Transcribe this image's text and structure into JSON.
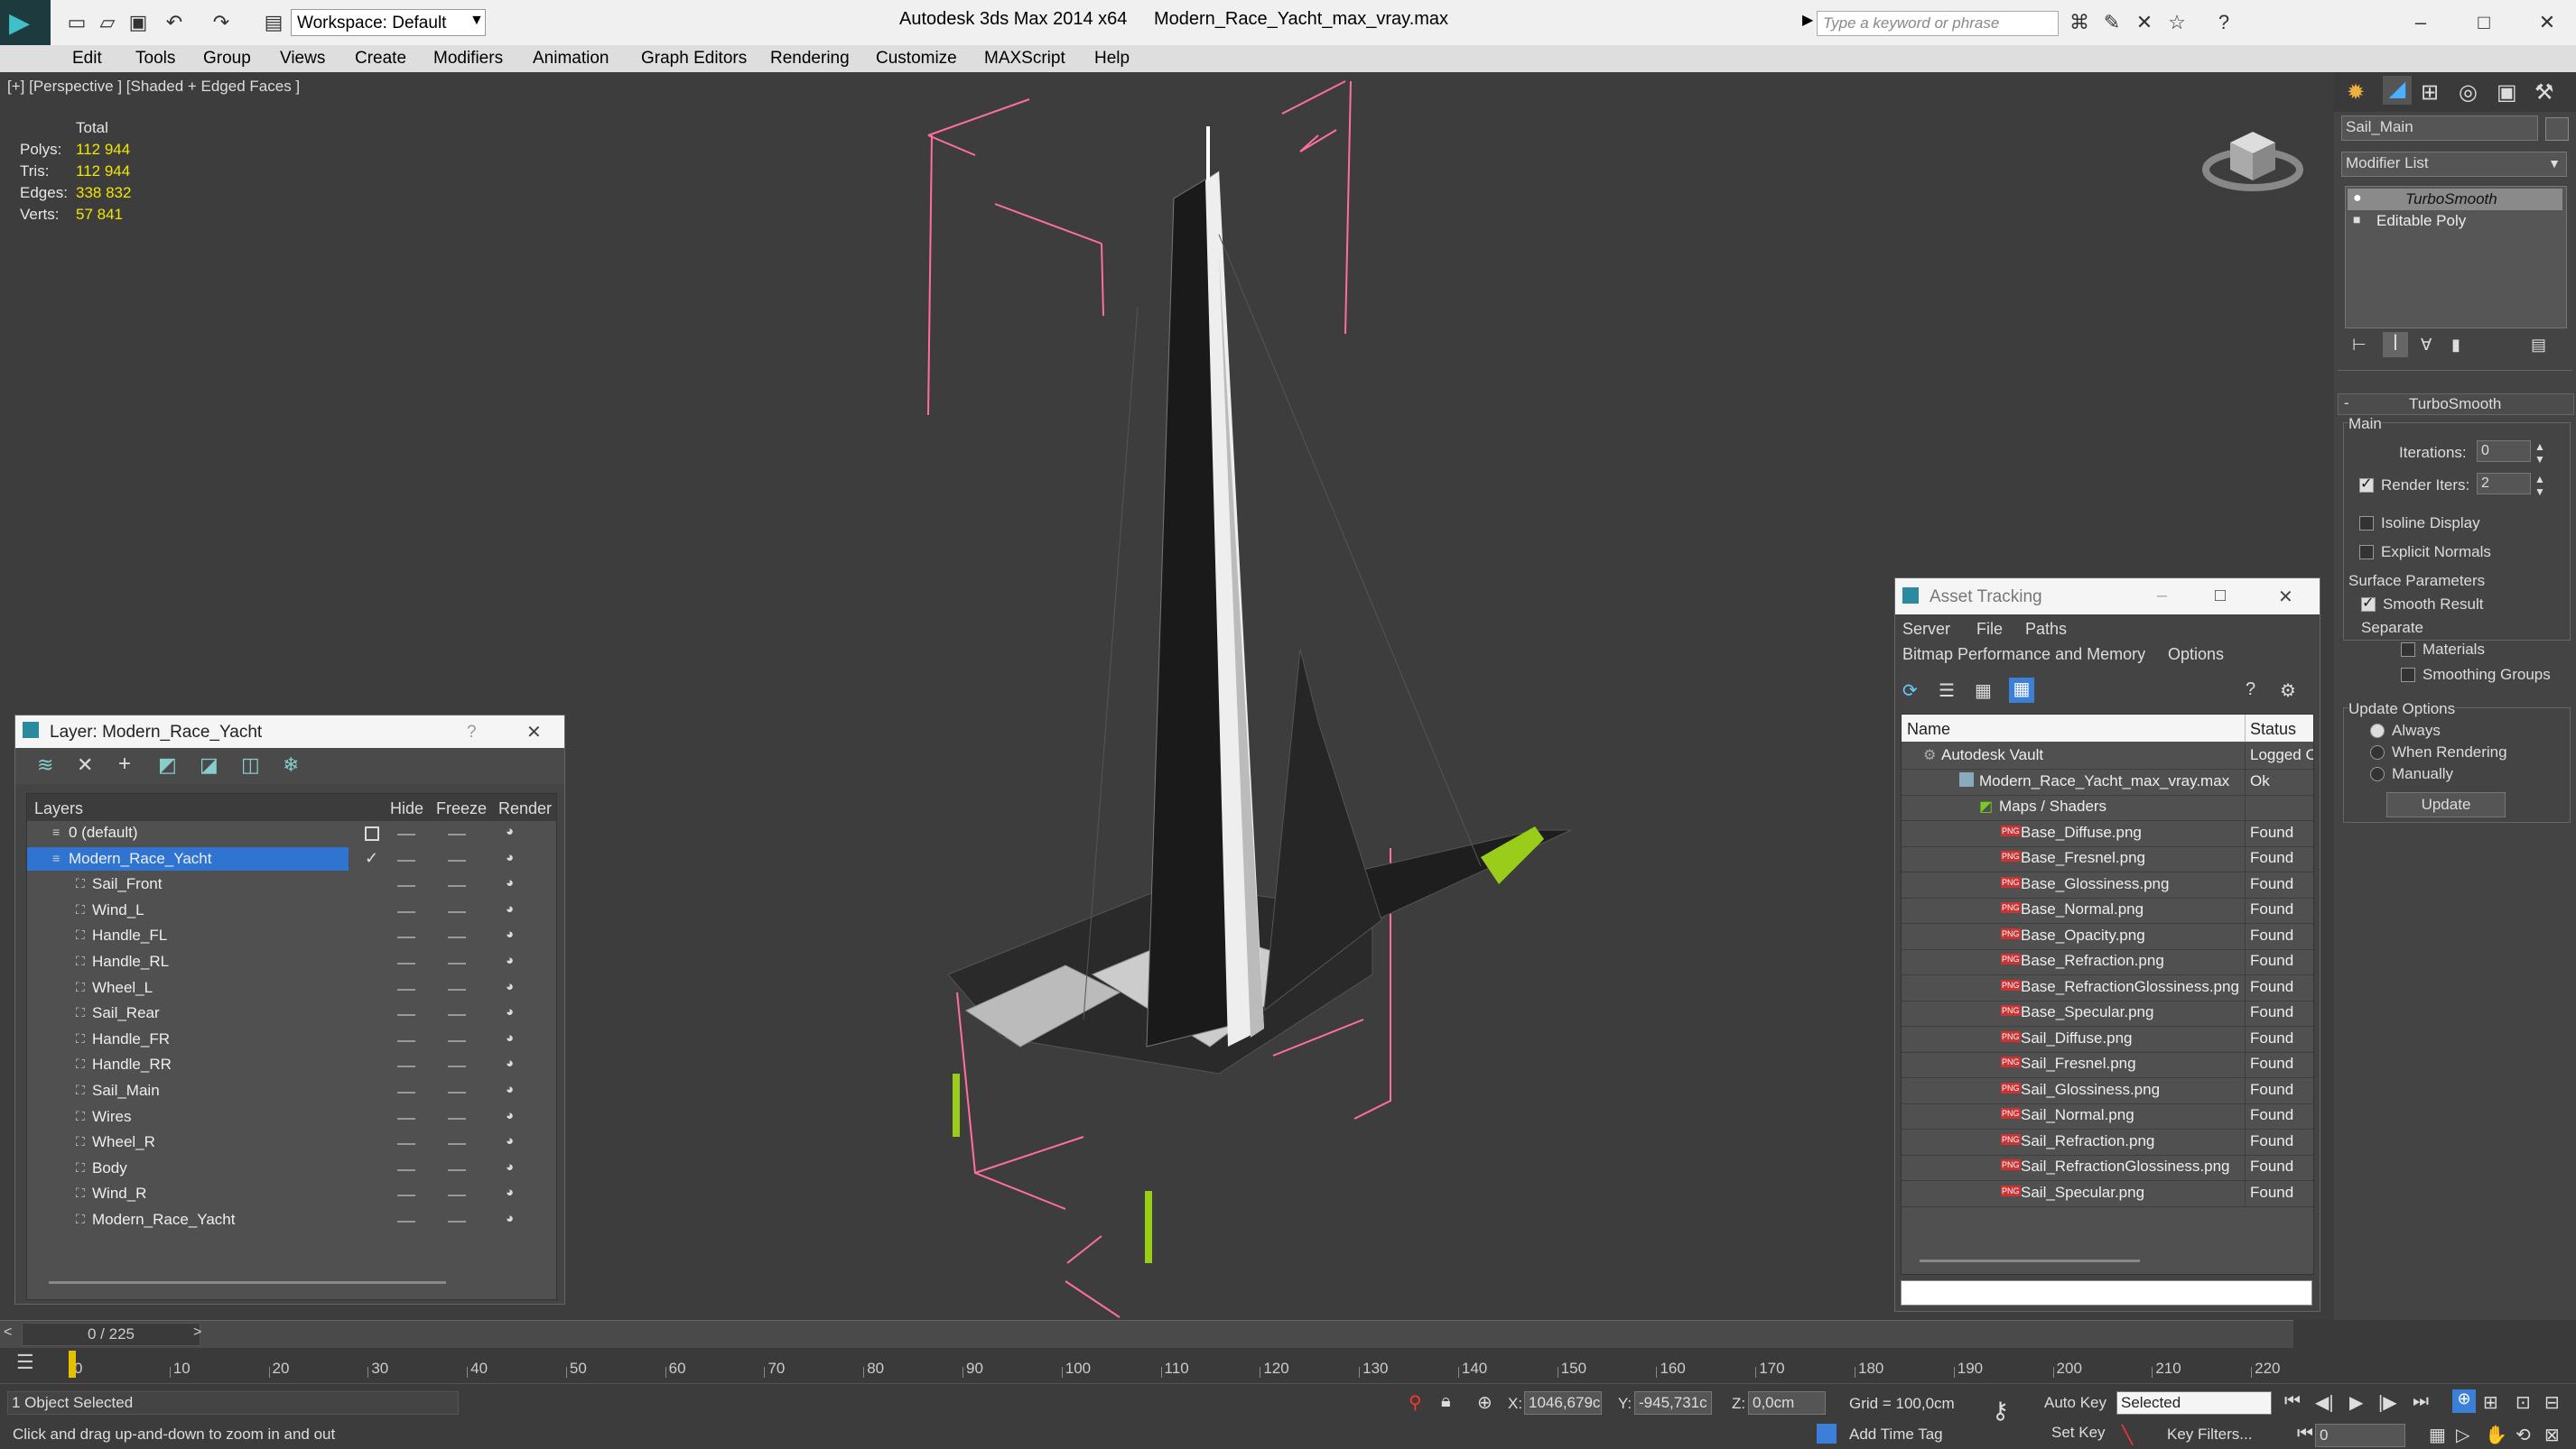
{
  "app": {
    "title": "Autodesk 3ds Max  2014 x64",
    "file": "Modern_Race_Yacht_max_vray.max",
    "workspace": "Workspace: Default",
    "search_placeholder": "Type a keyword or phrase"
  },
  "menu": [
    "Edit",
    "Tools",
    "Group",
    "Views",
    "Create",
    "Modifiers",
    "Animation",
    "Graph Editors",
    "Rendering",
    "Customize",
    "MAXScript",
    "Help"
  ],
  "viewport": {
    "label": "[+] [Perspective ] [Shaded + Edged Faces ]",
    "stats_header": "Total",
    "stats": [
      {
        "k": "Polys:",
        "v": "112 944"
      },
      {
        "k": "Tris:",
        "v": "112 944"
      },
      {
        "k": "Edges:",
        "v": "338 832"
      },
      {
        "k": "Verts:",
        "v": "57 841"
      }
    ]
  },
  "layer_panel": {
    "title": "Layer: Modern_Race_Yacht",
    "help": "?",
    "cols": {
      "layers": "Layers",
      "hide": "Hide",
      "freeze": "Freeze",
      "render": "Render"
    },
    "layers": [
      "0 (default)",
      "Modern_Race_Yacht"
    ],
    "objects": [
      "Sail_Front",
      "Wind_L",
      "Handle_FL",
      "Handle_RL",
      "Wheel_L",
      "Sail_Rear",
      "Handle_FR",
      "Handle_RR",
      "Sail_Main",
      "Wires",
      "Wheel_R",
      "Body",
      "Wind_R",
      "Modern_Race_Yacht"
    ]
  },
  "asset_panel": {
    "title": "Asset Tracking",
    "menu1": [
      "Server",
      "File",
      "Paths"
    ],
    "menu2": [
      "Bitmap Performance and Memory",
      "Options"
    ],
    "cols": {
      "name": "Name",
      "status": "Status"
    },
    "vault": {
      "name": "Autodesk Vault",
      "status": "Logged C"
    },
    "file": {
      "name": "Modern_Race_Yacht_max_vray.max",
      "status": "Ok"
    },
    "maps": "Maps / Shaders",
    "assets": [
      "Base_Diffuse.png",
      "Base_Fresnel.png",
      "Base_Glossiness.png",
      "Base_Normal.png",
      "Base_Opacity.png",
      "Base_Refraction.png",
      "Base_RefractionGlossiness.png",
      "Base_Specular.png",
      "Sail_Diffuse.png",
      "Sail_Fresnel.png",
      "Sail_Glossiness.png",
      "Sail_Normal.png",
      "Sail_Refraction.png",
      "Sail_RefractionGlossiness.png",
      "Sail_Specular.png"
    ],
    "found": "Found",
    "png": "PNG"
  },
  "command_panel": {
    "object_name": "Sail_Main",
    "modifier_list": "Modifier List",
    "stack": [
      "TurboSmooth",
      "Editable Poly"
    ],
    "rollout": "TurboSmooth",
    "main": "Main",
    "iterations_label": "Iterations:",
    "iterations": "0",
    "render_iters_label": "Render Iters:",
    "render_iters": "2",
    "isoline": "Isoline Display",
    "explicit": "Explicit Normals",
    "surface": "Surface Parameters",
    "smooth_result": "Smooth Result",
    "separate": "Separate",
    "materials": "Materials",
    "smoothing_groups": "Smoothing Groups",
    "update_options": "Update Options",
    "always": "Always",
    "when_rendering": "When Rendering",
    "manually": "Manually",
    "update": "Update"
  },
  "timeline": {
    "frame": "0 / 225",
    "ticks": [
      "0",
      "10",
      "20",
      "30",
      "40",
      "50",
      "60",
      "70",
      "80",
      "90",
      "100",
      "110",
      "120",
      "130",
      "140",
      "150",
      "160",
      "170",
      "180",
      "190",
      "200",
      "210",
      "220"
    ]
  },
  "status": {
    "selected": "1 Object Selected",
    "hint": "Click and drag up-and-down to zoom in and out",
    "x_label": "X:",
    "x": "1046,679c",
    "y_label": "Y:",
    "y": "-945,731c",
    "z_label": "Z:",
    "z": "0,0cm",
    "grid": "Grid = 100,0cm",
    "add_time_tag": "Add Time Tag",
    "auto_key": "Auto Key",
    "set_key": "Set Key",
    "selected_mode": "Selected",
    "key_filters": "Key Filters...",
    "frame_field": "0"
  }
}
